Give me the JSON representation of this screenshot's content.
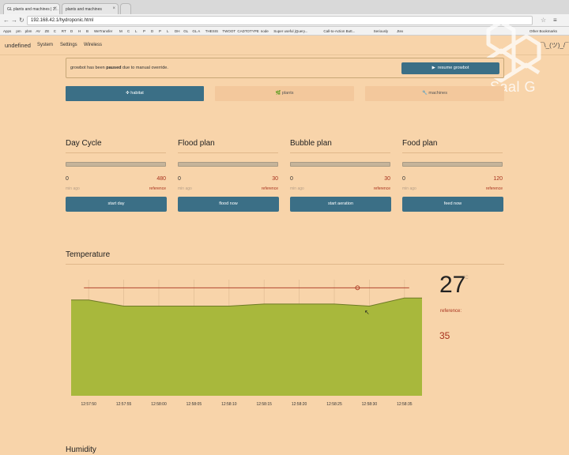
{
  "browser": {
    "tabs": [
      {
        "label": "GL plants and machines | 3..."
      },
      {
        "label": "plants and machines"
      }
    ],
    "url": "192.168.42.1/hydroponic.html",
    "bookmarks": [
      "Apps",
      "pm",
      "pbm",
      "AV",
      "ZE",
      "C",
      "RT",
      "D",
      "H",
      "B",
      "WeTransfer",
      "M",
      "C",
      "L",
      "P",
      "D",
      "P",
      "L",
      "DH",
      "GL",
      "GL A",
      "THESIS",
      "TWOOT",
      "CADTOTYPE",
      "node",
      "Super useful jQuery...",
      "Call-to-Action Butt...",
      "Seriously",
      "Jtex"
    ],
    "other_bookmarks": "Other Bookmarks"
  },
  "nav": {
    "brand": "undefined",
    "links": [
      "System",
      "Settings",
      "Wireless"
    ],
    "shrug": "¯\\_(ツ)_/¯"
  },
  "watermark": {
    "text": "Saal G"
  },
  "alert": {
    "prefix": "growbot has been ",
    "bold": "paused",
    "suffix": " due to manual override.",
    "button": "resume growbot"
  },
  "sections": {
    "habitat": "✜ habitat",
    "plants": "🌿 plants",
    "machines": "🔧 machines"
  },
  "cycles": [
    {
      "title": "Day Cycle",
      "value": "0",
      "max": "480",
      "sub": "min ago",
      "ref": "reference",
      "button": "start day",
      "progress": 0
    },
    {
      "title": "Flood plan",
      "value": "0",
      "max": "30",
      "sub": "min ago",
      "ref": "reference",
      "button": "flood now",
      "progress": 0
    },
    {
      "title": "Bubble plan",
      "value": "0",
      "max": "30",
      "sub": "min ago",
      "ref": "reference",
      "button": "start aeration",
      "progress": 0
    },
    {
      "title": "Food plan",
      "value": "0",
      "max": "120",
      "sub": "min ago",
      "ref": "reference",
      "button": "feed now",
      "progress": 0
    }
  ],
  "temperature": {
    "title": "Temperature",
    "current": "27",
    "unit": "°C",
    "ref_label": "reference:",
    "ref_value": "35"
  },
  "humidity": {
    "title": "Humidity"
  },
  "colors": {
    "background": "#f8d4aa",
    "accent": "#3b6f86",
    "reference": "#a8321e",
    "area_fill": "#a8b83c"
  },
  "chart_data": {
    "type": "area",
    "x": [
      "12:57:50",
      "12:57:55",
      "12:58:00",
      "12:58:05",
      "12:58:10",
      "12:58:15",
      "12:58:20",
      "12:58:25",
      "12:58:30",
      "12:58:35"
    ],
    "series": [
      {
        "values": [
          27.0,
          26.7,
          26.7,
          26.7,
          26.7,
          26.8,
          26.8,
          26.8,
          26.7,
          27.1
        ]
      }
    ],
    "reference_line": 27.6,
    "ylim": [
      22.3,
      28.0
    ],
    "grid": "vertical"
  }
}
